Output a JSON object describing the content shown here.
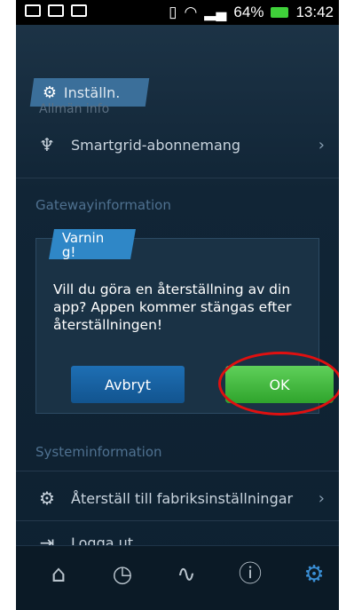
{
  "statusbar": {
    "battery": "64%",
    "time": "13:42"
  },
  "header": {
    "tab_label": "Inställn.",
    "ghost_text": "Allmän info"
  },
  "rows": {
    "smartgrid": "Smartgrid-abonnemang",
    "factory_reset": "Återställ till fabriksinställningar",
    "logout": "Logga ut"
  },
  "sections": {
    "gateway": "Gatewayinformation",
    "system": "Systeminformation"
  },
  "dialog": {
    "tag": "Varning!",
    "message": "Vill du göra en återställning av din app? Appen kommer stängas efter återställningen!",
    "cancel_label": "Avbryt",
    "ok_label": "OK"
  },
  "colors": {
    "accent_blue": "#2f87c7",
    "ok_green": "#3fb83a",
    "highlight_red": "#e01010"
  }
}
